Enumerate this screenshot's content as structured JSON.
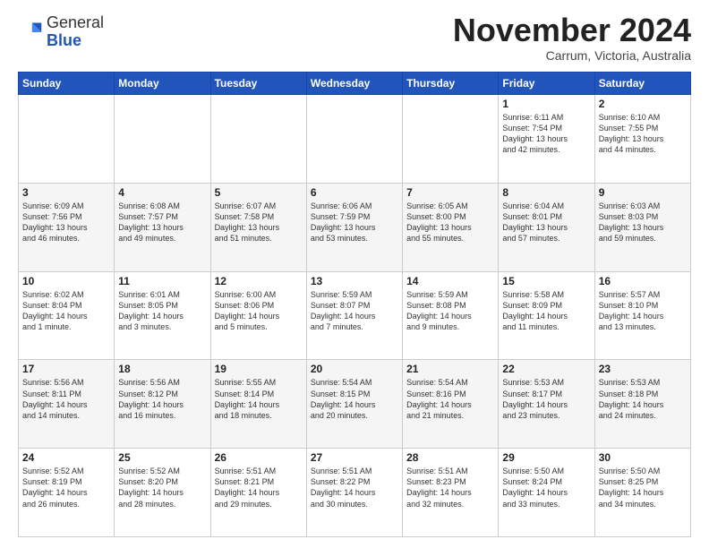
{
  "header": {
    "logo_line1": "General",
    "logo_line2": "Blue",
    "month_title": "November 2024",
    "location": "Carrum, Victoria, Australia"
  },
  "weekdays": [
    "Sunday",
    "Monday",
    "Tuesday",
    "Wednesday",
    "Thursday",
    "Friday",
    "Saturday"
  ],
  "weeks": [
    [
      {
        "day": "",
        "info": ""
      },
      {
        "day": "",
        "info": ""
      },
      {
        "day": "",
        "info": ""
      },
      {
        "day": "",
        "info": ""
      },
      {
        "day": "",
        "info": ""
      },
      {
        "day": "1",
        "info": "Sunrise: 6:11 AM\nSunset: 7:54 PM\nDaylight: 13 hours\nand 42 minutes."
      },
      {
        "day": "2",
        "info": "Sunrise: 6:10 AM\nSunset: 7:55 PM\nDaylight: 13 hours\nand 44 minutes."
      }
    ],
    [
      {
        "day": "3",
        "info": "Sunrise: 6:09 AM\nSunset: 7:56 PM\nDaylight: 13 hours\nand 46 minutes."
      },
      {
        "day": "4",
        "info": "Sunrise: 6:08 AM\nSunset: 7:57 PM\nDaylight: 13 hours\nand 49 minutes."
      },
      {
        "day": "5",
        "info": "Sunrise: 6:07 AM\nSunset: 7:58 PM\nDaylight: 13 hours\nand 51 minutes."
      },
      {
        "day": "6",
        "info": "Sunrise: 6:06 AM\nSunset: 7:59 PM\nDaylight: 13 hours\nand 53 minutes."
      },
      {
        "day": "7",
        "info": "Sunrise: 6:05 AM\nSunset: 8:00 PM\nDaylight: 13 hours\nand 55 minutes."
      },
      {
        "day": "8",
        "info": "Sunrise: 6:04 AM\nSunset: 8:01 PM\nDaylight: 13 hours\nand 57 minutes."
      },
      {
        "day": "9",
        "info": "Sunrise: 6:03 AM\nSunset: 8:03 PM\nDaylight: 13 hours\nand 59 minutes."
      }
    ],
    [
      {
        "day": "10",
        "info": "Sunrise: 6:02 AM\nSunset: 8:04 PM\nDaylight: 14 hours\nand 1 minute."
      },
      {
        "day": "11",
        "info": "Sunrise: 6:01 AM\nSunset: 8:05 PM\nDaylight: 14 hours\nand 3 minutes."
      },
      {
        "day": "12",
        "info": "Sunrise: 6:00 AM\nSunset: 8:06 PM\nDaylight: 14 hours\nand 5 minutes."
      },
      {
        "day": "13",
        "info": "Sunrise: 5:59 AM\nSunset: 8:07 PM\nDaylight: 14 hours\nand 7 minutes."
      },
      {
        "day": "14",
        "info": "Sunrise: 5:59 AM\nSunset: 8:08 PM\nDaylight: 14 hours\nand 9 minutes."
      },
      {
        "day": "15",
        "info": "Sunrise: 5:58 AM\nSunset: 8:09 PM\nDaylight: 14 hours\nand 11 minutes."
      },
      {
        "day": "16",
        "info": "Sunrise: 5:57 AM\nSunset: 8:10 PM\nDaylight: 14 hours\nand 13 minutes."
      }
    ],
    [
      {
        "day": "17",
        "info": "Sunrise: 5:56 AM\nSunset: 8:11 PM\nDaylight: 14 hours\nand 14 minutes."
      },
      {
        "day": "18",
        "info": "Sunrise: 5:56 AM\nSunset: 8:12 PM\nDaylight: 14 hours\nand 16 minutes."
      },
      {
        "day": "19",
        "info": "Sunrise: 5:55 AM\nSunset: 8:14 PM\nDaylight: 14 hours\nand 18 minutes."
      },
      {
        "day": "20",
        "info": "Sunrise: 5:54 AM\nSunset: 8:15 PM\nDaylight: 14 hours\nand 20 minutes."
      },
      {
        "day": "21",
        "info": "Sunrise: 5:54 AM\nSunset: 8:16 PM\nDaylight: 14 hours\nand 21 minutes."
      },
      {
        "day": "22",
        "info": "Sunrise: 5:53 AM\nSunset: 8:17 PM\nDaylight: 14 hours\nand 23 minutes."
      },
      {
        "day": "23",
        "info": "Sunrise: 5:53 AM\nSunset: 8:18 PM\nDaylight: 14 hours\nand 24 minutes."
      }
    ],
    [
      {
        "day": "24",
        "info": "Sunrise: 5:52 AM\nSunset: 8:19 PM\nDaylight: 14 hours\nand 26 minutes."
      },
      {
        "day": "25",
        "info": "Sunrise: 5:52 AM\nSunset: 8:20 PM\nDaylight: 14 hours\nand 28 minutes."
      },
      {
        "day": "26",
        "info": "Sunrise: 5:51 AM\nSunset: 8:21 PM\nDaylight: 14 hours\nand 29 minutes."
      },
      {
        "day": "27",
        "info": "Sunrise: 5:51 AM\nSunset: 8:22 PM\nDaylight: 14 hours\nand 30 minutes."
      },
      {
        "day": "28",
        "info": "Sunrise: 5:51 AM\nSunset: 8:23 PM\nDaylight: 14 hours\nand 32 minutes."
      },
      {
        "day": "29",
        "info": "Sunrise: 5:50 AM\nSunset: 8:24 PM\nDaylight: 14 hours\nand 33 minutes."
      },
      {
        "day": "30",
        "info": "Sunrise: 5:50 AM\nSunset: 8:25 PM\nDaylight: 14 hours\nand 34 minutes."
      }
    ]
  ]
}
